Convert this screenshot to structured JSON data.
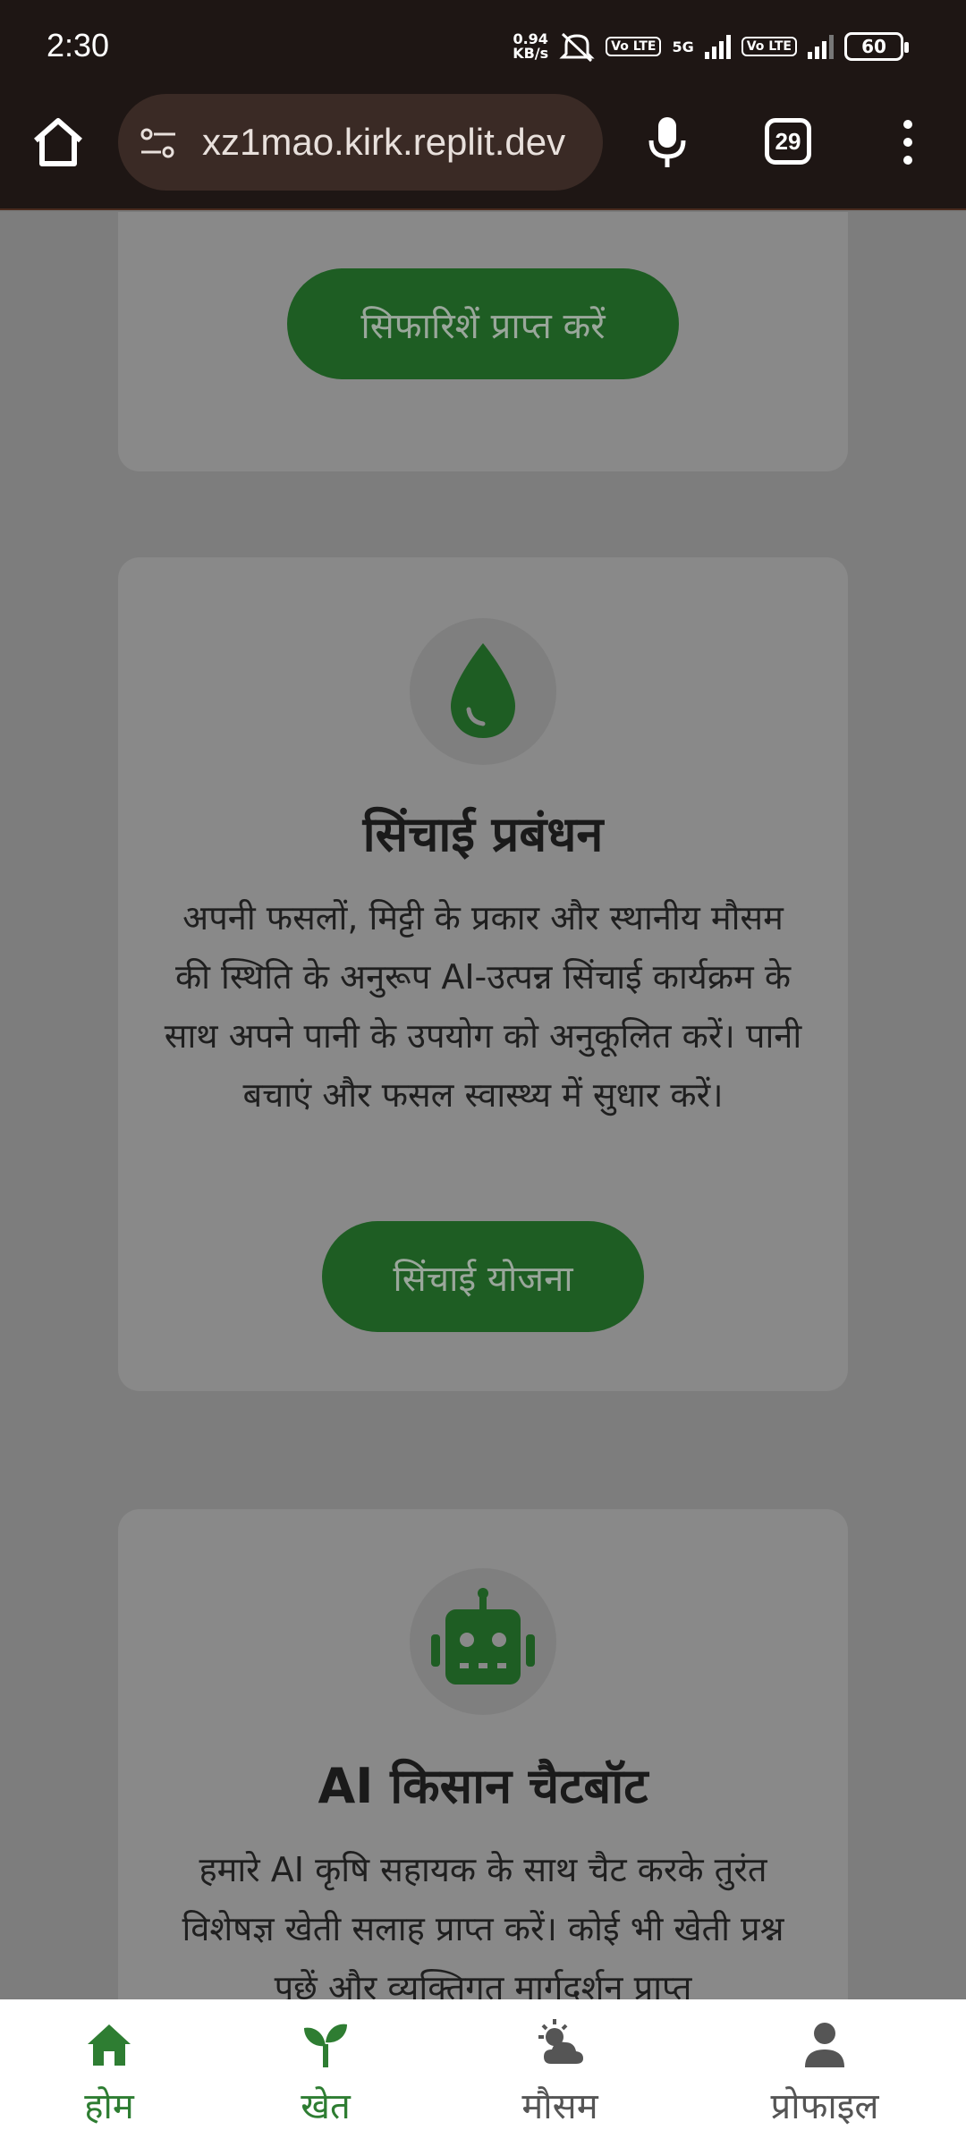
{
  "status_bar": {
    "time": "2:30",
    "net_speed_value": "0.94",
    "net_speed_unit": "KB/s",
    "network": "5G",
    "volte1": "Vo LTE",
    "volte2": "Vo LTE",
    "battery": "60"
  },
  "browser": {
    "url": "xz1mao.kirk.replit.dev",
    "tab_count": "29"
  },
  "cards": [
    {
      "button_label": "सिफारिशें प्राप्त करें"
    },
    {
      "icon": "water-drop-icon",
      "title": "सिंचाई प्रबंधन",
      "description": "अपनी फसलों, मिट्टी के प्रकार और स्थानीय मौसम की स्थिति के अनुरूप AI-उत्पन्न सिंचाई कार्यक्रम के साथ अपने पानी के उपयोग को अनुकूलित करें। पानी बचाएं और फसल स्वास्थ्य में सुधार करें।",
      "button_label": "सिंचाई योजना"
    },
    {
      "icon": "robot-icon",
      "title": "AI किसान चैटबॉट",
      "description": "हमारे AI कृषि सहायक के साथ चैट करके तुरंत विशेषज्ञ खेती सलाह प्राप्त करें। कोई भी खेती प्रश्न पूछें और व्यक्तिगत मार्गदर्शन प्राप्त"
    }
  ],
  "bottom_nav": [
    {
      "label": "होम",
      "icon": "home-icon",
      "active": true
    },
    {
      "label": "खेत",
      "icon": "sprout-icon",
      "active": false
    },
    {
      "label": "मौसम",
      "icon": "weather-icon",
      "active": false
    },
    {
      "label": "प्रोफाइल",
      "icon": "user-icon",
      "active": false
    }
  ],
  "colors": {
    "primary_green": "#1e5d23",
    "nav_active": "#2e7d32",
    "browser_bg": "#1e1614"
  }
}
